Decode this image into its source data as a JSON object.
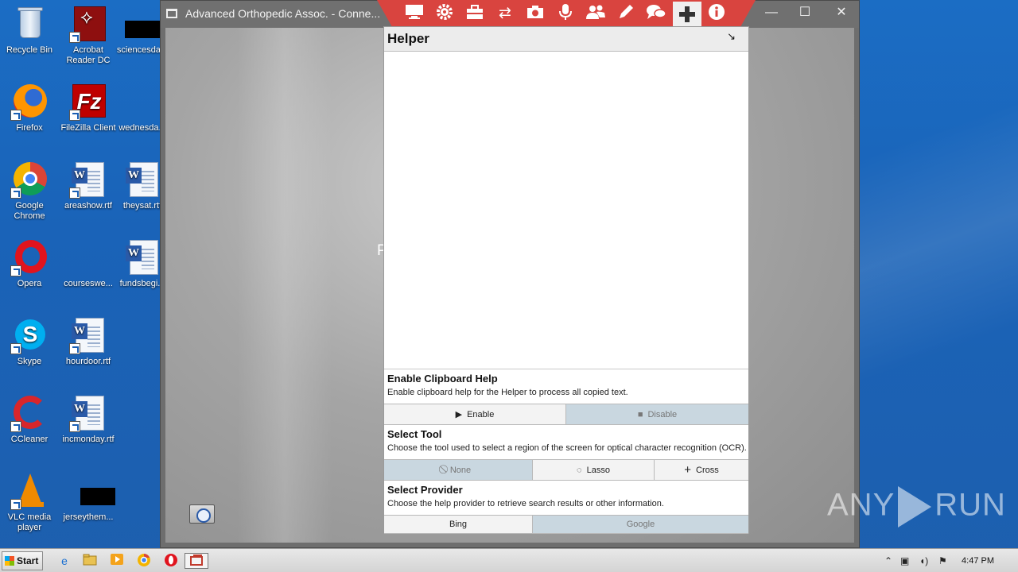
{
  "desktop": {
    "icons": [
      {
        "label": "Recycle Bin",
        "icon": "recycle-bin-icon"
      },
      {
        "label": "Acrobat Reader DC",
        "icon": "acrobat-icon"
      },
      {
        "label": "sciencesda...",
        "icon": "file-icon"
      },
      {
        "label": "Firefox",
        "icon": "firefox-icon"
      },
      {
        "label": "FileZilla Client",
        "icon": "filezilla-icon"
      },
      {
        "label": "wednesda...",
        "icon": "file-icon"
      },
      {
        "label": "Google Chrome",
        "icon": "chrome-icon"
      },
      {
        "label": "areashow.rtf",
        "icon": "word-doc-icon"
      },
      {
        "label": "theysat.rtf",
        "icon": "word-doc-icon"
      },
      {
        "label": "Opera",
        "icon": "opera-icon"
      },
      {
        "label": "courseswe...",
        "icon": "file-icon"
      },
      {
        "label": "fundsbegi...",
        "icon": "word-doc-icon"
      },
      {
        "label": "Skype",
        "icon": "skype-icon"
      },
      {
        "label": "hourdoor.rtf",
        "icon": "word-doc-icon"
      },
      {
        "label": "CCleaner",
        "icon": "ccleaner-icon"
      },
      {
        "label": "incmonday.rtf",
        "icon": "word-doc-icon"
      },
      {
        "label": "VLC media player",
        "icon": "vlc-icon"
      },
      {
        "label": "jerseythem...",
        "icon": "file-icon"
      }
    ]
  },
  "remote_window": {
    "title": "Advanced Orthopedic Assoc. - Conne...",
    "minimize": "—",
    "maximize": "☐",
    "close": "✕",
    "remote_text": "P"
  },
  "toolbar": {
    "icons": [
      "monitor-icon",
      "gear-icon",
      "toolbox-icon",
      "transfer-icon",
      "camera-icon",
      "microphone-icon",
      "users-icon",
      "pencil-icon",
      "chat-icon",
      "plus-icon",
      "info-icon"
    ],
    "active": "plus-icon"
  },
  "helper": {
    "title": "Helper",
    "resize_glyph": "↘",
    "clipboard": {
      "title": "Enable Clipboard Help",
      "desc": "Enable clipboard help for the Helper to process all copied text.",
      "enable": "Enable",
      "disable": "Disable",
      "selected": "disable"
    },
    "tool": {
      "title": "Select Tool",
      "desc": "Choose the tool used to select a region of the screen for optical character recognition (OCR).",
      "none": "None",
      "lasso": "Lasso",
      "cross": "Cross",
      "selected": "none"
    },
    "provider": {
      "title": "Select Provider",
      "desc": "Choose the help provider to retrieve search results or other information.",
      "bing": "Bing",
      "google": "Google",
      "selected": "google"
    }
  },
  "taskbar": {
    "start": "Start",
    "apps": [
      "ie-icon",
      "explorer-icon",
      "media-player-icon",
      "chrome-icon",
      "opera-icon",
      "remote-session-icon"
    ],
    "clock": "4:47 PM"
  },
  "watermark": {
    "left": "ANY",
    "right": "RUN"
  },
  "colors": {
    "toolbar": "#d9443f",
    "desktop": "#1a63b8",
    "selected_option": "#c9d7e0"
  }
}
